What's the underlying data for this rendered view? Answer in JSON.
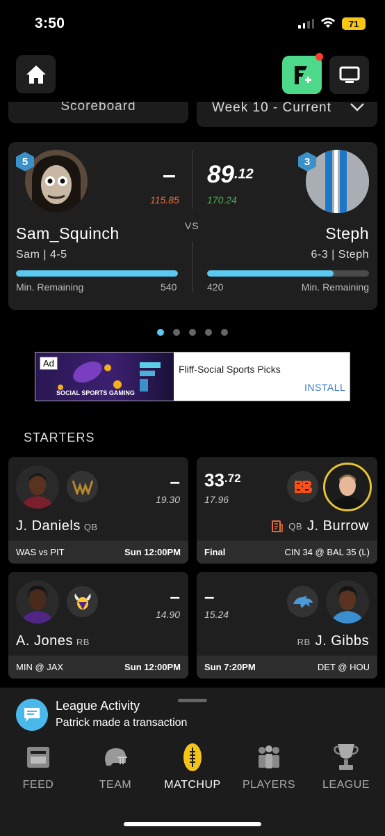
{
  "status": {
    "time": "3:50",
    "battery": "71"
  },
  "tabs": {
    "scoreboard": "Scoreboard",
    "week": "Week 10 - Current"
  },
  "matchup": {
    "left": {
      "rank": "5",
      "score": "–",
      "projected": "115.85",
      "name": "Sam_Squinch",
      "record": "Sam | 4-5",
      "progress": 1.0,
      "min_label": "Min. Remaining",
      "min_value": "540"
    },
    "right": {
      "rank": "3",
      "score_int": "89",
      "score_dec": ".12",
      "projected": "170.24",
      "name": "Steph",
      "record": "6-3 | Steph",
      "progress": 0.78,
      "min_label": "Min. Remaining",
      "min_value": "420"
    },
    "vs": "VS"
  },
  "ad": {
    "tag": "Ad",
    "title": "Fliff-Social Sports Picks",
    "cta": "INSTALL",
    "image_text": "SOCIAL SPORTS GAMING"
  },
  "starters_label": "STARTERS",
  "players": [
    {
      "score": "–",
      "proj": "19.30",
      "name": "J. Daniels",
      "pos": "QB",
      "foot_left": "WAS vs PIT",
      "foot_right": "Sun 12:00PM",
      "team": "WAS"
    },
    {
      "score_int": "33",
      "score_dec": ".72",
      "proj": "17.96",
      "name": "J. Burrow",
      "pos": "QB",
      "foot_left": "Final",
      "foot_right": "CIN 34 @ BAL 35 (L)",
      "team": "CIN"
    },
    {
      "score": "–",
      "proj": "14.90",
      "name": "A. Jones",
      "pos": "RB",
      "foot_left": "MIN @ JAX",
      "foot_right": "Sun 12:00PM",
      "team": "MIN"
    },
    {
      "score": "–",
      "proj": "15.24",
      "name": "J. Gibbs",
      "pos": "RB",
      "foot_left": "Sun 7:20PM",
      "foot_right": "DET @ HOU",
      "team": "DET"
    }
  ],
  "activity": {
    "title": "League Activity",
    "text": "Patrick made a transaction"
  },
  "nav": {
    "feed": "FEED",
    "team": "TEAM",
    "matchup": "MATCHUP",
    "players": "PLAYERS",
    "league": "LEAGUE"
  },
  "colors": {
    "accent": "#5ac8f0",
    "negative": "#e86a3a",
    "positive": "#4caf50",
    "fliff": "#4cd98a",
    "rank_badge": "#3a90c8"
  }
}
